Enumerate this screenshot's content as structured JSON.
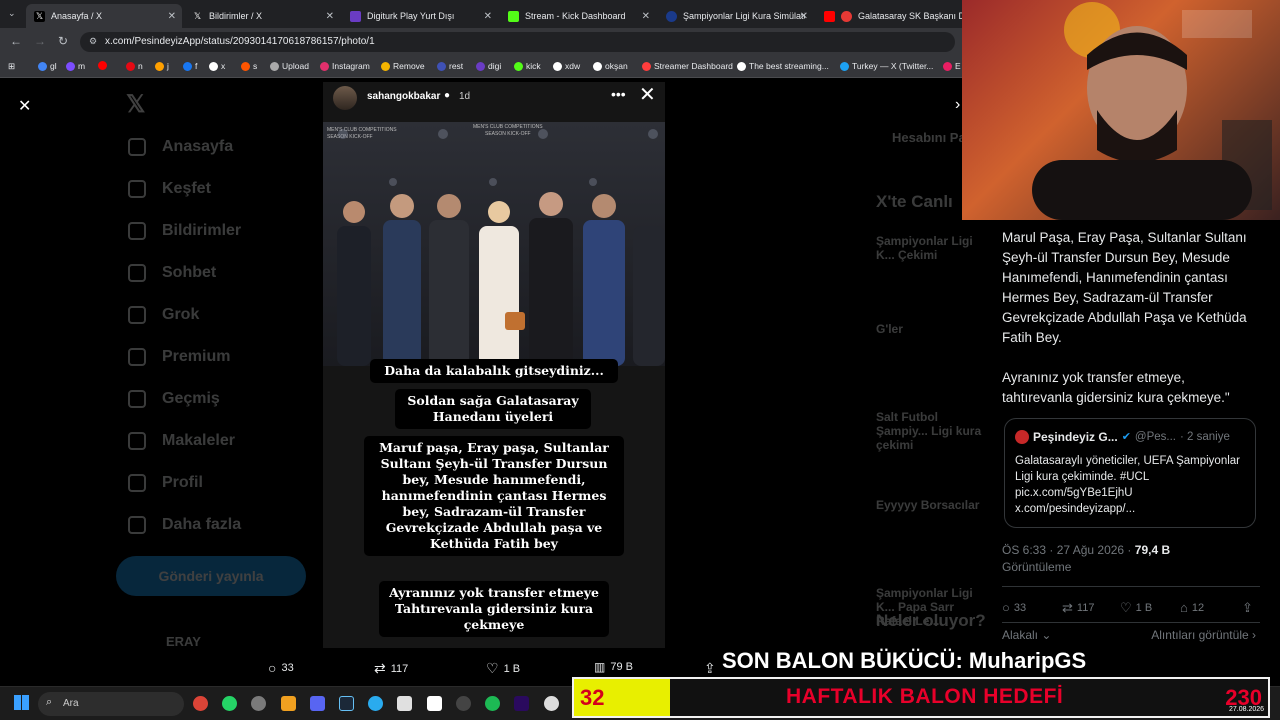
{
  "tabs": [
    {
      "label": "Anasayfa / X",
      "color": "#000000"
    },
    {
      "label": "Bildirimler / X",
      "color": "#000000"
    },
    {
      "label": "Digiturk Play Yurt Dışı",
      "color": "#6a3cc4"
    },
    {
      "label": "Stream - Kick Dashboard",
      "color": "#53fc18"
    },
    {
      "label": "Şampiyonlar Ligi Kura Simülatö",
      "color": "#1a3a8a"
    },
    {
      "label": "Galatasaray SK Başkanı Dun",
      "color": "#ff0000"
    }
  ],
  "address": {
    "url": "x.com/PesindeyizApp/status/2093014170618786157/photo/1"
  },
  "bookmarks": [
    {
      "label": "gl",
      "color": "#4285f4"
    },
    {
      "label": "m",
      "color": "#7c4dff"
    },
    {
      "label": "",
      "color": "#ff0000"
    },
    {
      "label": "n",
      "color": "#e50914"
    },
    {
      "label": "j",
      "color": "#ffa000"
    },
    {
      "label": "f",
      "color": "#1877f2"
    },
    {
      "label": "x",
      "color": "#ffffff"
    },
    {
      "label": "s",
      "color": "#ff5500"
    },
    {
      "label": "Upload",
      "color": "#aaaaaa"
    },
    {
      "label": "Instagram",
      "color": "#e1306c"
    },
    {
      "label": "Remove",
      "color": "#f4b400"
    },
    {
      "label": "rest",
      "color": "#3f51b5"
    },
    {
      "label": "digi",
      "color": "#6a3cc4"
    },
    {
      "label": "kick",
      "color": "#53fc18"
    },
    {
      "label": "xdw",
      "color": "#ffffff"
    },
    {
      "label": "okşan",
      "color": "#ffffff"
    },
    {
      "label": "Streamer Dashboard",
      "color": "#ff3d3d"
    },
    {
      "label": "The best streaming...",
      "color": "#ffffff"
    },
    {
      "label": "Turkey — X (Twitter...",
      "color": "#1da1f2"
    },
    {
      "label": "E",
      "color": "#e91e63"
    }
  ],
  "sidebar": {
    "items": [
      {
        "label": "Anasayfa"
      },
      {
        "label": "Keşfet"
      },
      {
        "label": "Bildirimler"
      },
      {
        "label": "Sohbet"
      },
      {
        "label": "Grok"
      },
      {
        "label": "Premium"
      },
      {
        "label": "Geçmiş"
      },
      {
        "label": "Makaleler"
      },
      {
        "label": "Profil"
      },
      {
        "label": "Daha fazla"
      }
    ],
    "post_button": "Gönderi yayınla",
    "account": "ERAY"
  },
  "story": {
    "username": "sahangokbakar",
    "time": "1d",
    "captions": [
      "Daha da kalabalık gitseydiniz...",
      "Soldan sağa Galatasaray Hanedanı üyeleri",
      "Maruf paşa, Eray paşa,  Sultanlar Sultanı Şeyh-ül Transfer Dursun bey, Mesude hanımefendi, hanımefendinin çantası Hermes bey,  Sadrazam-ül Transfer Gevrekçizade Abdullah paşa ve Kethüda Fatih bey",
      "Ayranınız yok transfer etmeye Tahtırevanla gidersiniz kura çekmeye"
    ],
    "banner_lines": [
      "MEN'S CLUB COMPETITIONS",
      "SEASON KICK-OFF"
    ]
  },
  "tweet": {
    "text_part1": "Marul Paşa, Eray Paşa, Sultanlar Sultanı Şeyh-ül Transfer Dursun Bey, Mesude Hanımefendi, Hanımefendinin çantası Hermes Bey, Sadrazam-ül Transfer Gevrekçizade Abdullah Paşa ve Kethüda Fatih Bey.",
    "text_part2": "Ayranınız yok transfer etmeye, tahtırevanla gidersiniz kura çekmeye.\"",
    "quote": {
      "name": "Peşindeyiz G...",
      "handle": "@Pes...",
      "time": "· 2 saniye",
      "text": "Galatasaraylı yöneticiler, UEFA Şampiyonlar Ligi kura çekiminde. #UCL pic.x.com/5gYBe1EjhU x.com/pesindeyizapp/..."
    },
    "timestamp": "ÖS 6:33 · 27 Ağu 2026 · ",
    "views_count": "79,4 B",
    "views_label": "Görüntüleme",
    "actions": {
      "replies": "33",
      "reposts": "117",
      "likes": "1 B",
      "bookmarks": "12"
    },
    "sort_label": "Alakalı",
    "quotes_link": "Alıntıları görüntüle"
  },
  "lightbox_actions": {
    "replies": "33",
    "reposts": "117",
    "likes": "1 B",
    "views": "79 B"
  },
  "background_trends": {
    "title": "X'te Canlı",
    "items": [
      "Şampiyonlar Ligi K... Çekimi",
      "G'ler",
      "Salt Futbol Şampiy... Ligi kura çekimi",
      "Eyyyyy Borsacılar",
      "Şampiyonlar Ligi K... Papa Sarr Rafael Le..."
    ],
    "whats_happening": "Neler oluyor?",
    "signup": "Hesabını Pa..."
  },
  "overlay": {
    "donor_text": "SON BALON BÜKÜCÜ: MuharipGS",
    "goal_current": "32",
    "goal_title": "HAFTALIK BALON HEDEFİ",
    "goal_target": "230",
    "goal_fraction": 0.139
  },
  "taskbar": {
    "search_placeholder": "Ara",
    "time": "",
    "date": "27.08.2026"
  }
}
